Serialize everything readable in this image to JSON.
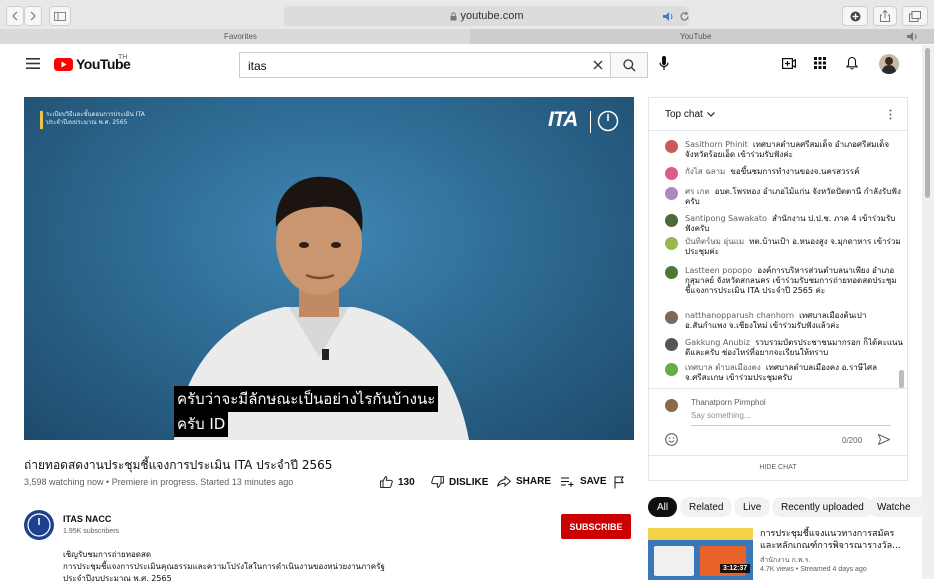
{
  "browser": {
    "url": "youtube.com",
    "favorites_label": "Favorites",
    "tab_label": "YouTube"
  },
  "header": {
    "logo_text": "YouTube",
    "logo_region": "TH",
    "search_value": "itas"
  },
  "video": {
    "overlay_text_line1": "ระเบียบวิธีและขั้นตอนการประเมิน ITA",
    "overlay_text_line2": "ประจำปีงบประมาณ พ.ศ. 2565",
    "ita_logo": "ITA",
    "subtitle_line1": "ครับว่าจะมีลักษณะเป็นอย่างไรกันบ้างนะ",
    "subtitle_line2": "ครับ ID",
    "title": "ถ่ายทอดสดงานประชุมชี้แจงการประเมิน ITA ประจำปี 2565",
    "stats": "3,598 watching now • Premiere in progress. Started 13 minutes ago",
    "like_count": "130",
    "dislike_label": "DISLIKE",
    "share_label": "SHARE",
    "save_label": "SAVE"
  },
  "channel": {
    "name": "ITAS NACC",
    "subscribers": "1.95K subscribers",
    "subscribe_label": "SUBSCRIBE",
    "desc_line1": "เชิญรับชมการถ่ายทอดสด",
    "desc_line2": "การประชุมชี้แจงการประเมินคุณธรรมและความโปร่งใสในการดำเนินงานของหน่วยงานภาครัฐ",
    "desc_line3": "ประจำปีงบประมาณ พ.ศ. 2565"
  },
  "chat": {
    "header": "Top chat",
    "messages": [
      {
        "author": "Sasithorn Phinit",
        "text": "เทศบาลตำบลศรีสมเด็จ อำเภอศรีสมเด็จ จังหวัดร้อยเอ็ด เข้าร่วมรับฟังค่ะ",
        "color": "#c85a5a"
      },
      {
        "author": "กังไส ฉลาม",
        "text": "ขอขึ้นชมการทำงานของจ.นครสวรรค์",
        "color": "#e05a8a"
      },
      {
        "author": "ศร เกต",
        "text": "อบต.โพรทอง อำเภอไม้แก่น จังหวัดปัตตานี กำลังรับฟังครับ",
        "color": "#a98abf"
      },
      {
        "author": "Santipong Sawakato",
        "text": "สำนักงาน ป.ป.ช. ภาค 4 เข้าร่วมรับฟังครับ",
        "color": "#4a6a3a"
      },
      {
        "author": "บันทิตร์ษม อุ่นแม",
        "text": "ทต.บ้านเป้า อ.หนองสูง จ.มุกดาหาร เข้าร่วมประชุมค่ะ",
        "color": "#9ab84a"
      },
      {
        "author": "Lastteen popopo",
        "text": "องค์การบริหารส่วนตำบลนาเพียง อำเภอกุสุมาลย์ จังหวัดสกลนคร เข้าร่วมรับชมการถ่ายทอดสดประชุมชี้แจงการประเมิน ITA ประจำปี 2565 ค่ะ",
        "color": "#4a7a3a"
      },
      {
        "author": "natthanopparush chanhorn",
        "text": "เทศบาลเมืองต้นเปา อ.สันกำแพง จ.เชียงใหม่ เข้าร่วมรับฟังแล้วค่ะ",
        "color": "#7a6a5a"
      },
      {
        "author": "Gakkung Anubiz",
        "text": "รวบรวมบัตรประชาชนมากรอก ก็ได้คะแนนดีและครับ ช่องไหร่ที่อยากจะเรียนให้ทราบ",
        "color": "#555555"
      },
      {
        "author": "เทศบาล ตำบลเมืองคง",
        "text": "เทศบาลตำบลเมืองคง อ.ราษีไศล จ.ศรีสะเกษ เข้าร่วมประชุมครับ",
        "color": "#6aa84a"
      }
    ],
    "current_user": "Thanatporn Pirmphol",
    "input_placeholder": "Say something...",
    "char_count": "0/200",
    "hide_label": "HIDE CHAT"
  },
  "chips": [
    "All",
    "Related",
    "Live",
    "Recently uploaded",
    "Watche"
  ],
  "related": {
    "title_line1": "การประชุมชี้แจงแนวทางการสมัคร",
    "title_line2": "และหลักเกณฑ์การพิจารณารางวัล...",
    "channel": "สำนักงาน ก.พ.ร.",
    "meta": "4.7K views • Streamed 4 days ago",
    "duration": "3:12:37"
  }
}
